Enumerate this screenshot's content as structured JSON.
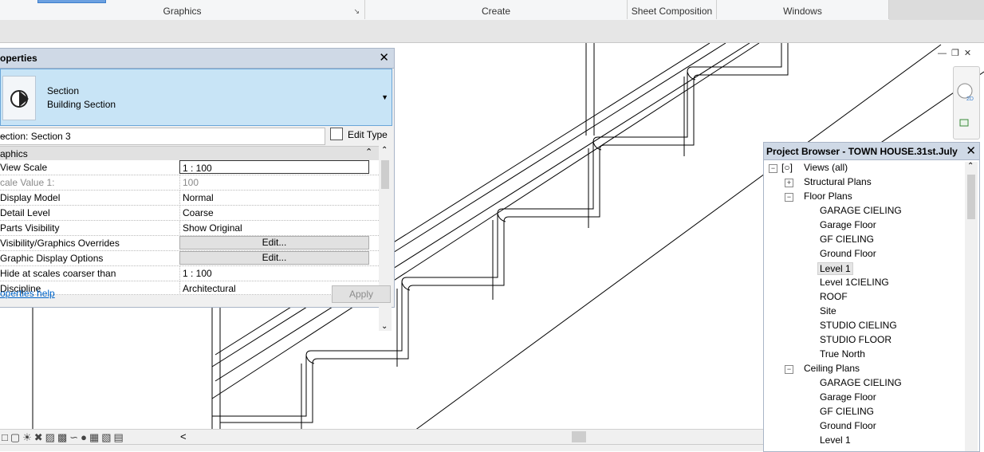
{
  "ribbon": {
    "groups": [
      {
        "label": "Graphics"
      },
      {
        "label": "Create"
      },
      {
        "label": "Sheet Composition"
      },
      {
        "label": "Windows"
      }
    ]
  },
  "properties": {
    "title": "operties",
    "type_name": "Section",
    "type_family": "Building Section",
    "instance_selector": "ection: Section 3",
    "edit_type_label": "Edit Type",
    "category": "aphics",
    "rows": [
      {
        "key": "View Scale",
        "value": "1 : 100"
      },
      {
        "key": "cale Value    1:",
        "value": "100"
      },
      {
        "key": "Display Model",
        "value": "Normal"
      },
      {
        "key": "Detail Level",
        "value": "Coarse"
      },
      {
        "key": "Parts Visibility",
        "value": "Show Original"
      },
      {
        "key": "Visibility/Graphics Overrides",
        "value": "Edit..."
      },
      {
        "key": "Graphic Display Options",
        "value": "Edit..."
      },
      {
        "key": "Hide at scales coarser than",
        "value": "1 : 100"
      },
      {
        "key": "Discipline",
        "value": "Architectural"
      }
    ],
    "help_link": "operties help",
    "apply_label": "Apply"
  },
  "project_browser": {
    "title": "Project Browser - TOWN HOUSE.31st.July",
    "views_all": "Views (all)",
    "structural_plans": "Structural Plans",
    "floor_plans": "Floor Plans",
    "floor_plan_items": [
      "GARAGE CIELING",
      "Garage Floor",
      "GF CIELING",
      "Ground Floor",
      "Level 1",
      "Level 1CIELING",
      "ROOF",
      "Site",
      "STUDIO CIELING",
      "STUDIO FLOOR",
      "True North"
    ],
    "ceiling_plans": "Ceiling Plans",
    "ceiling_plan_items": [
      "GARAGE CIELING",
      "Garage Floor",
      "GF CIELING",
      "Ground Floor",
      "Level 1"
    ],
    "selected": "Level 1"
  },
  "view_control_bar": {
    "scroll_left": "<"
  }
}
